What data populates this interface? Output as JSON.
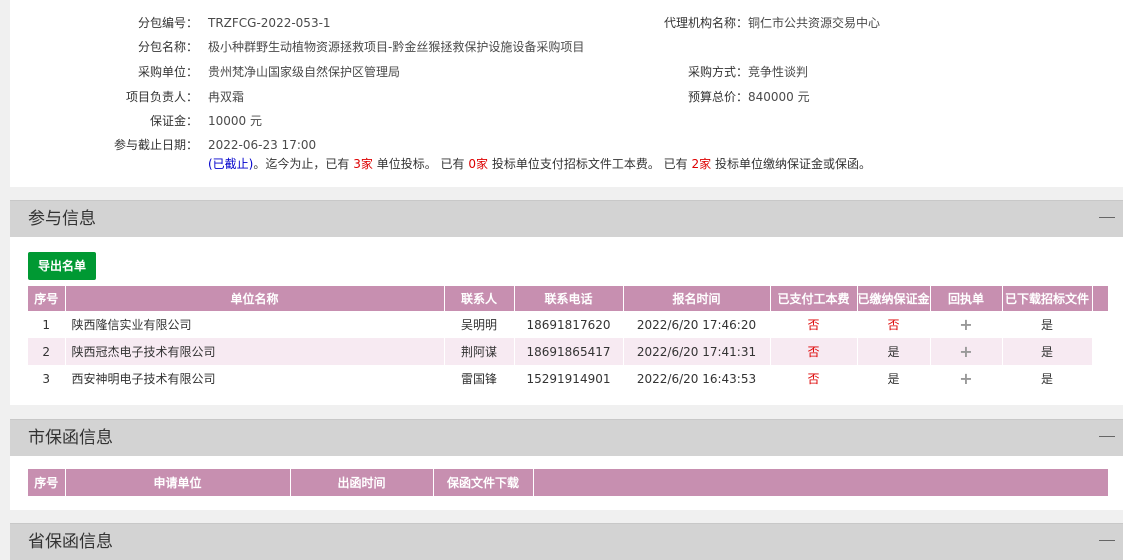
{
  "info": {
    "package_no": {
      "label": "分包编号：",
      "value": "TRZFCG-2022-053-1"
    },
    "agency": {
      "label": "代理机构名称：",
      "value": "铜仁市公共资源交易中心"
    },
    "package_name": {
      "label": "分包名称：",
      "value": "极小种群野生动植物资源拯救项目-黔金丝猴拯救保护设施设备采购项目"
    },
    "purchaser": {
      "label": "采购单位：",
      "value": "贵州梵净山国家级自然保护区管理局"
    },
    "method": {
      "label": "采购方式：",
      "value": "竞争性谈判"
    },
    "manager": {
      "label": "项目负责人：",
      "value": "冉双霜"
    },
    "budget": {
      "label": "预算总价：",
      "value": "840000 元"
    },
    "deposit": {
      "label": "保证金：",
      "value": "10000 元"
    },
    "deadline": {
      "label": "参与截止日期：",
      "value": "2022-06-23 17:00"
    },
    "status": {
      "closed": "(已截止)",
      "text1": "。迄今为止，已有",
      "n1": "3家",
      "text2": "单位投标。 已有",
      "n2": "0家",
      "text3": "投标单位支付招标文件工本费。 已有",
      "n3": "2家",
      "text4": "投标单位缴纳保证金或保函。"
    }
  },
  "participation": {
    "title": "参与信息",
    "export_label": "导出名单",
    "headers": [
      "序号",
      "单位名称",
      "联系人",
      "联系电话",
      "报名时间",
      "已支付工本费",
      "已缴纳保证金",
      "回执单",
      "已下载招标文件"
    ],
    "rows": [
      {
        "no": "1",
        "name": "陕西隆信实业有限公司",
        "contact": "吴明明",
        "phone": "18691817620",
        "time": "2022/6/20 17:46:20",
        "paid": "否",
        "deposit": "否",
        "receipt": "+",
        "downloaded": "是"
      },
      {
        "no": "2",
        "name": "陕西冠杰电子技术有限公司",
        "contact": "荆阿谋",
        "phone": "18691865417",
        "time": "2022/6/20 17:41:31",
        "paid": "否",
        "deposit": "是",
        "receipt": "+",
        "downloaded": "是"
      },
      {
        "no": "3",
        "name": "西安神明电子技术有限公司",
        "contact": "雷国锋",
        "phone": "15291914901",
        "time": "2022/6/20 16:43:53",
        "paid": "否",
        "deposit": "是",
        "receipt": "+",
        "downloaded": "是"
      }
    ]
  },
  "city_guarantee": {
    "title": "市保函信息",
    "headers": [
      "序号",
      "申请单位",
      "出函时间",
      "保函文件下载",
      ""
    ]
  },
  "province_guarantee": {
    "title": "省保函信息"
  },
  "colors": {
    "header_purple": "#c78fb0",
    "export_green": "#009933",
    "negative_red": "#dd0000",
    "closed_blue": "#0000cc"
  }
}
